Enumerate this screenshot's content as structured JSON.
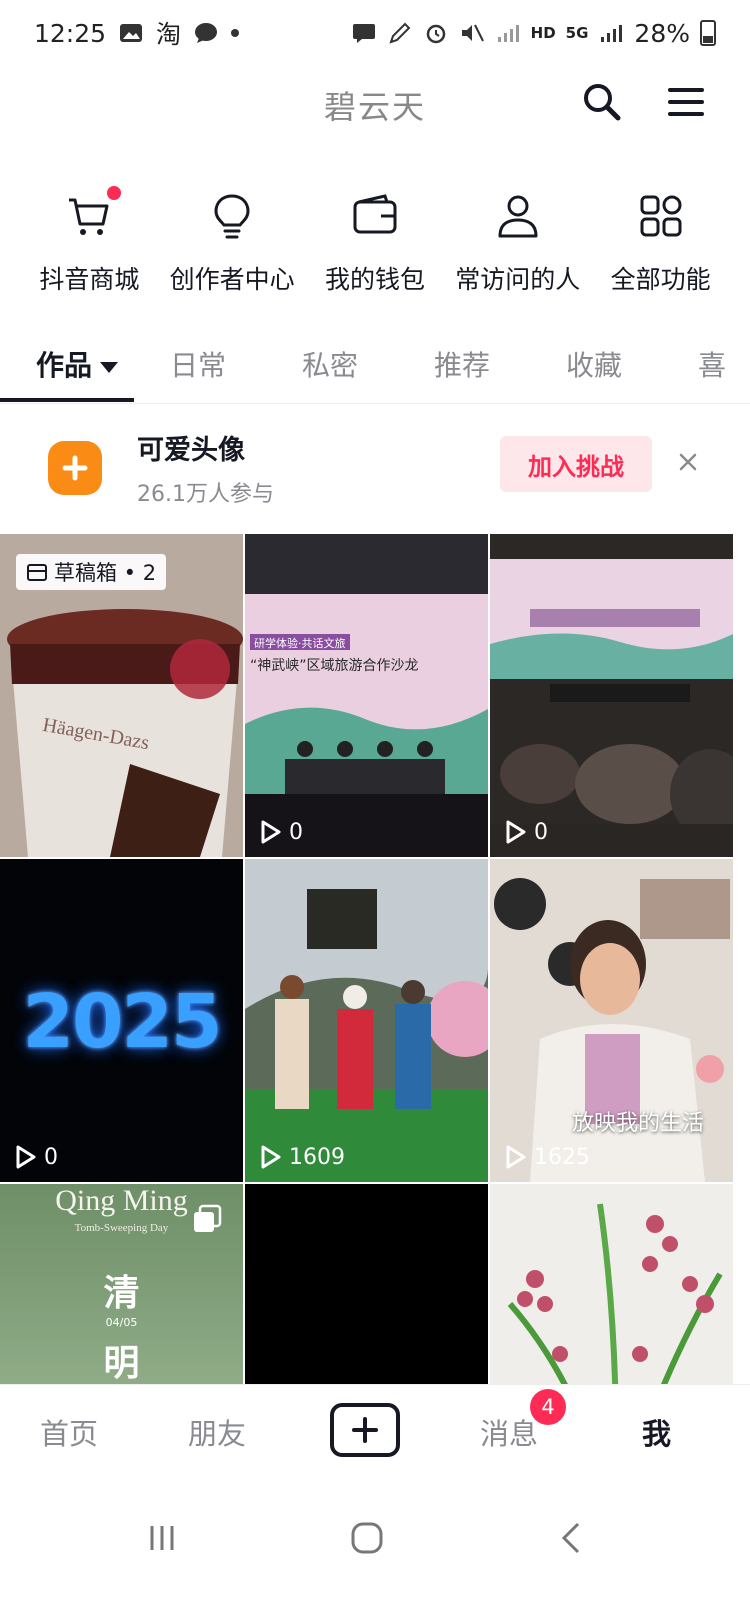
{
  "status_bar": {
    "time": "12:25",
    "app_indicator": "淘",
    "network": "HD",
    "signal_5g": "5G",
    "battery": "28%"
  },
  "header": {
    "title": "碧云天",
    "icons": [
      "search-icon",
      "menu-icon"
    ]
  },
  "shortcuts": [
    {
      "label": "抖音商城",
      "icon": "cart-icon",
      "has_dot": true
    },
    {
      "label": "创作者中心",
      "icon": "lightbulb-icon"
    },
    {
      "label": "我的钱包",
      "icon": "wallet-icon"
    },
    {
      "label": "常访问的人",
      "icon": "person-icon"
    },
    {
      "label": "全部功能",
      "icon": "grid-icon"
    }
  ],
  "tabs": [
    {
      "label": "作品",
      "active": true
    },
    {
      "label": "日常"
    },
    {
      "label": "私密"
    },
    {
      "label": "推荐"
    },
    {
      "label": "收藏"
    },
    {
      "label": "喜"
    }
  ],
  "challenge": {
    "title": "可爱头像",
    "subtitle": "26.1万人参与",
    "join_label": "加入挑战"
  },
  "grid": {
    "draft_label": "草稿箱 • 2",
    "tiles": [
      {
        "caption": "",
        "views": ""
      },
      {
        "caption": "",
        "views": "0"
      },
      {
        "caption": "",
        "views": "0"
      },
      {
        "caption": "2025",
        "views": "0"
      },
      {
        "caption": "",
        "views": "1609"
      },
      {
        "caption": "放映我的生活",
        "views": "1625"
      },
      {
        "caption": "Qing Ming",
        "views": ""
      },
      {
        "caption": "",
        "views": ""
      },
      {
        "caption": "",
        "views": ""
      }
    ],
    "poster_text": {
      "conference_line": "“神武峡”区域旅游合作沙龙",
      "conference_tag": "研学体验·共话文旅",
      "qingming_sub": "Tomb-Sweeping Day",
      "qingming_char1": "清",
      "qingming_date": "04/05",
      "qingming_char2": "明",
      "brand": "Häagen-Dazs"
    }
  },
  "bottom_nav": {
    "items": [
      {
        "label": "首页"
      },
      {
        "label": "朋友"
      },
      {
        "label": "消息",
        "badge": "4"
      },
      {
        "label": "我",
        "active": true
      }
    ]
  },
  "colors": {
    "accent": "#fe2c55",
    "challenge_orange": "#fa8c16",
    "text_primary": "#161823",
    "text_secondary": "#8a8b91"
  }
}
